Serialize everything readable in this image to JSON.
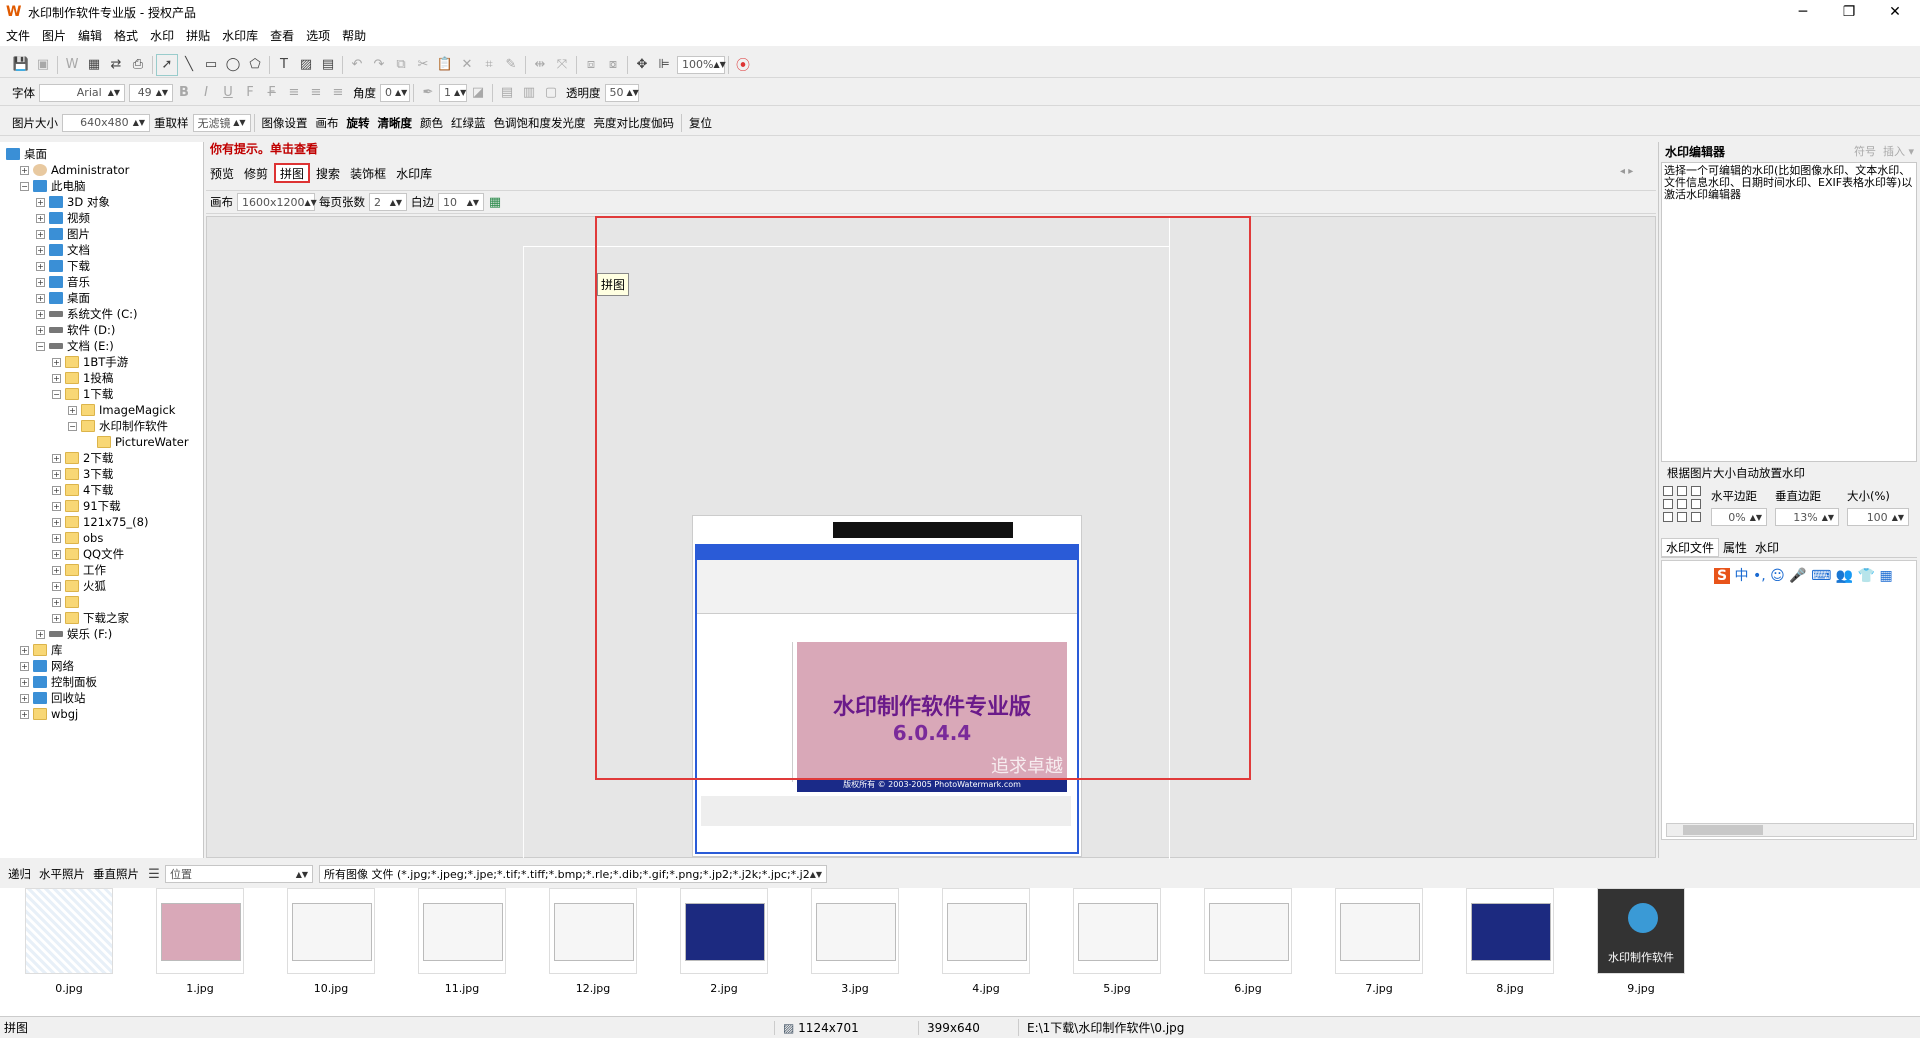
{
  "app": {
    "title": "水印制作软件专业版 - 授权产品"
  },
  "menu": [
    "文件",
    "图片",
    "编辑",
    "格式",
    "水印",
    "拼贴",
    "水印库",
    "查看",
    "选项",
    "帮助"
  ],
  "toolbar1": {
    "zoom": "100%"
  },
  "toolbar2": {
    "font_label": "字体",
    "font_value": "Arial",
    "size_value": "49",
    "angle_label": "角度",
    "angle_value": "0",
    "line_value": "1",
    "opacity_label": "透明度",
    "opacity_value": "50"
  },
  "toolbar3": {
    "image_size_label": "图片大小",
    "image_size_value": "640x480",
    "resample_label": "重取样",
    "filter_value": "无滤镜",
    "buttons": [
      "图像设置",
      "画布",
      "旋转",
      "清晰度",
      "颜色",
      "红绿蓝",
      "色调饱和度发光度",
      "亮度对比度伽码",
      "复位"
    ]
  },
  "tree": [
    {
      "label": "桌面",
      "level": 0,
      "type": "pc"
    },
    {
      "label": "Administrator",
      "level": 1,
      "type": "user"
    },
    {
      "label": "此电脑",
      "level": 1,
      "type": "pc"
    },
    {
      "label": "3D 对象",
      "level": 2,
      "type": "pc"
    },
    {
      "label": "视频",
      "level": 2,
      "type": "pc"
    },
    {
      "label": "图片",
      "level": 2,
      "type": "pc"
    },
    {
      "label": "文档",
      "level": 2,
      "type": "pc"
    },
    {
      "label": "下载",
      "level": 2,
      "type": "pc"
    },
    {
      "label": "音乐",
      "level": 2,
      "type": "pc"
    },
    {
      "label": "桌面",
      "level": 2,
      "type": "pc"
    },
    {
      "label": "系统文件 (C:)",
      "level": 2,
      "type": "drive"
    },
    {
      "label": "软件 (D:)",
      "level": 2,
      "type": "drive"
    },
    {
      "label": "文档 (E:)",
      "level": 2,
      "type": "drive"
    },
    {
      "label": "1BT手游",
      "level": 3,
      "type": "folder"
    },
    {
      "label": "1投稿",
      "level": 3,
      "type": "folder"
    },
    {
      "label": "1下载",
      "level": 3,
      "type": "folder"
    },
    {
      "label": "ImageMagick",
      "level": 4,
      "type": "folder"
    },
    {
      "label": "水印制作软件",
      "level": 4,
      "type": "folder"
    },
    {
      "label": "PictureWater",
      "level": 5,
      "type": "folder"
    },
    {
      "label": "2下载",
      "level": 3,
      "type": "folder"
    },
    {
      "label": "3下载",
      "level": 3,
      "type": "folder"
    },
    {
      "label": "4下载",
      "level": 3,
      "type": "folder"
    },
    {
      "label": "91下载",
      "level": 3,
      "type": "folder"
    },
    {
      "label": "121x75_(8)",
      "level": 3,
      "type": "folder"
    },
    {
      "label": "obs",
      "level": 3,
      "type": "folder"
    },
    {
      "label": "QQ文件",
      "level": 3,
      "type": "folder"
    },
    {
      "label": "工作",
      "level": 3,
      "type": "folder"
    },
    {
      "label": "火狐",
      "level": 3,
      "type": "folder"
    },
    {
      "label": "",
      "level": 3,
      "type": "folder"
    },
    {
      "label": "下载之家",
      "level": 3,
      "type": "folder"
    },
    {
      "label": "娱乐 (F:)",
      "level": 2,
      "type": "drive"
    },
    {
      "label": "库",
      "level": 1,
      "type": "folder"
    },
    {
      "label": "网络",
      "level": 1,
      "type": "pc"
    },
    {
      "label": "控制面板",
      "level": 1,
      "type": "pc"
    },
    {
      "label": "回收站",
      "level": 1,
      "type": "pc"
    },
    {
      "label": "wbgj",
      "level": 1,
      "type": "folder"
    }
  ],
  "hint": "你有提示。单击查看",
  "tabs": [
    "预览",
    "修剪",
    "拼图",
    "搜索",
    "装饰框",
    "水印库"
  ],
  "canvas_opts": {
    "canvas_label": "画布",
    "canvas_value": "1600x1200",
    "per_page_label": "每页张数",
    "per_page_value": "2",
    "margin_label": "白边",
    "margin_value": "10"
  },
  "tooltip": "拼图",
  "preview": {
    "title": "水印制作软件专业版",
    "version": "6.0.4.4",
    "watermark": "追求卓越",
    "copyright": "版权所有 © 2003-2005 PhotoWatermark.com"
  },
  "right": {
    "editor_title": "水印编辑器",
    "symbol_label": "符号",
    "insert_label": "插入",
    "editor_desc": "选择一个可编辑的水印(比如图像水印、文本水印、文件信息水印、日期时间水印、EXIF表格水印等)以激活水印编辑器",
    "auto_title": "根据图片大小自动放置水印",
    "h_margin_label": "水平边距",
    "v_margin_label": "垂直边距",
    "size_label": "大小(%)",
    "h_margin": "0%",
    "v_margin": "13%",
    "size": "100",
    "tabs": [
      "水印文件",
      "属性",
      "水印"
    ]
  },
  "bottom": {
    "buttons": [
      "递归",
      "水平照片",
      "垂直照片"
    ],
    "position_value": "位置",
    "filter_text": "所有图像 文件 (*.jpg;*.jpeg;*.jpe;*.tif;*.tiff;*.bmp;*.rle;*.dib;*.gif;*.png;*.jp2;*.j2k;*.jpc;*.j2c"
  },
  "thumbs": [
    "0.jpg",
    "1.jpg",
    "10.jpg",
    "11.jpg",
    "12.jpg",
    "2.jpg",
    "3.jpg",
    "4.jpg",
    "5.jpg",
    "6.jpg",
    "7.jpg",
    "8.jpg",
    "9.jpg"
  ],
  "thumb9_label": "水印制作软件",
  "status": {
    "mode": "拼图",
    "image_size": "1124x701",
    "cursor": "399x640",
    "path": "E:\\1下载\\水印制作软件\\0.jpg"
  }
}
